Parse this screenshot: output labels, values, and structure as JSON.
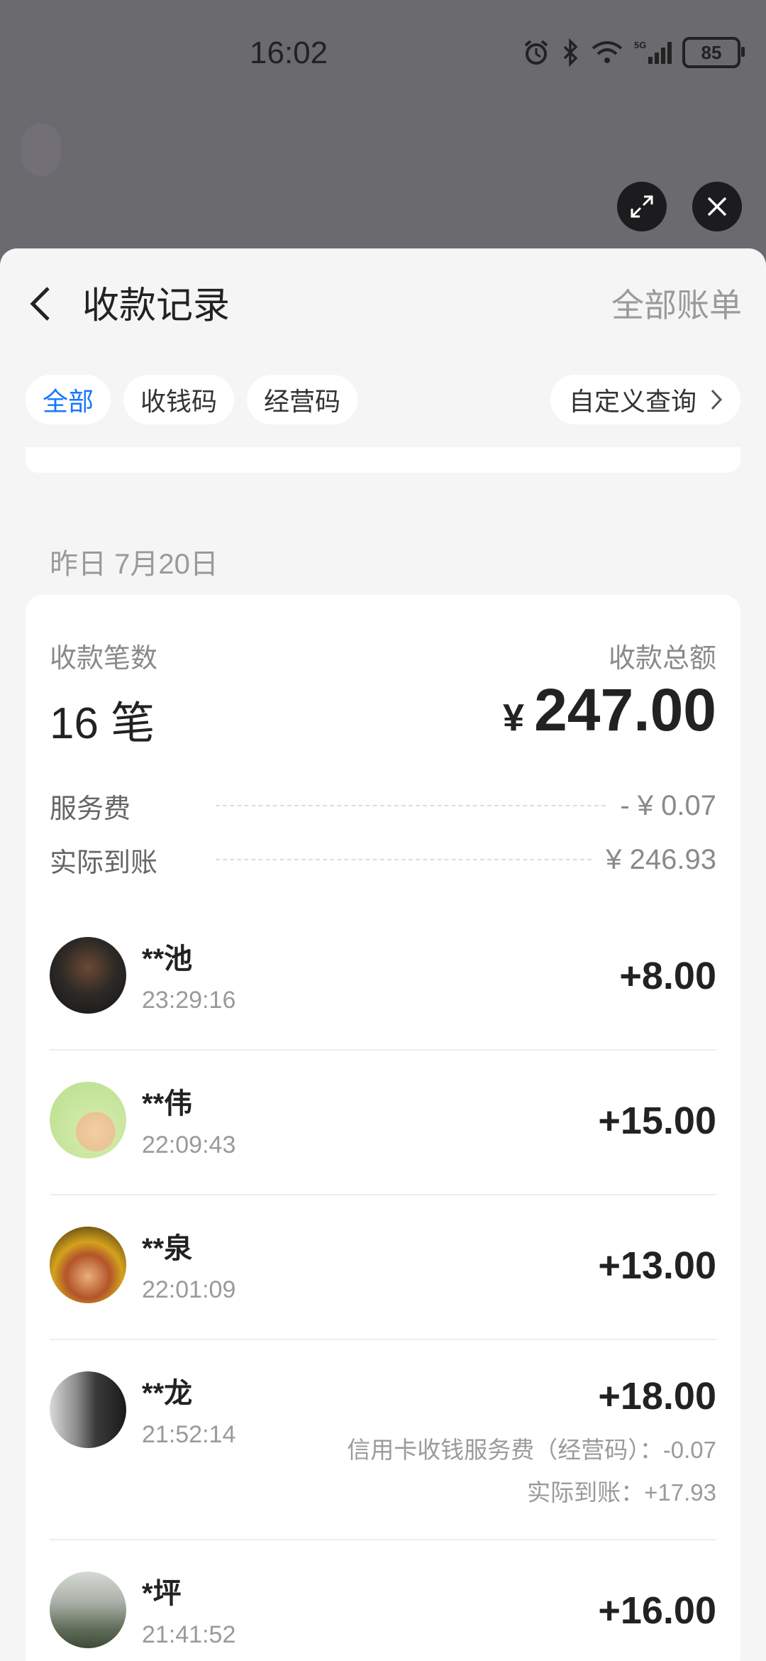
{
  "status": {
    "time": "16:02",
    "battery": "85"
  },
  "header": {
    "title": "收款记录",
    "all_bills": "全部账单"
  },
  "filters": {
    "chips": [
      "全部",
      "收钱码",
      "经营码"
    ],
    "custom_query": "自定义查询"
  },
  "summary": {
    "date": "昨日 7月20日",
    "count_label": "收款笔数",
    "count_value": "16 笔",
    "total_label": "收款总额",
    "currency": "¥",
    "total_value": "247.00",
    "fee_label": "服务费",
    "fee_value": "- ¥ 0.07",
    "net_label": "实际到账",
    "net_value": "¥ 246.93"
  },
  "transactions": [
    {
      "name": "**池",
      "time": "23:29:16",
      "amount": "+8.00"
    },
    {
      "name": "**伟",
      "time": "22:09:43",
      "amount": "+15.00"
    },
    {
      "name": "**泉",
      "time": "22:01:09",
      "amount": "+13.00"
    },
    {
      "name": "**龙",
      "time": "21:52:14",
      "amount": "+18.00",
      "note1": "信用卡收钱服务费（经营码）：-0.07",
      "note2": "实际到账：+17.93"
    },
    {
      "name": "*坪",
      "time": "21:41:52",
      "amount": "+16.00"
    }
  ],
  "colors": {
    "accent": "#1677ff",
    "sheet_bg": "#f5f5f5",
    "overlay": "#6b6a6f"
  }
}
